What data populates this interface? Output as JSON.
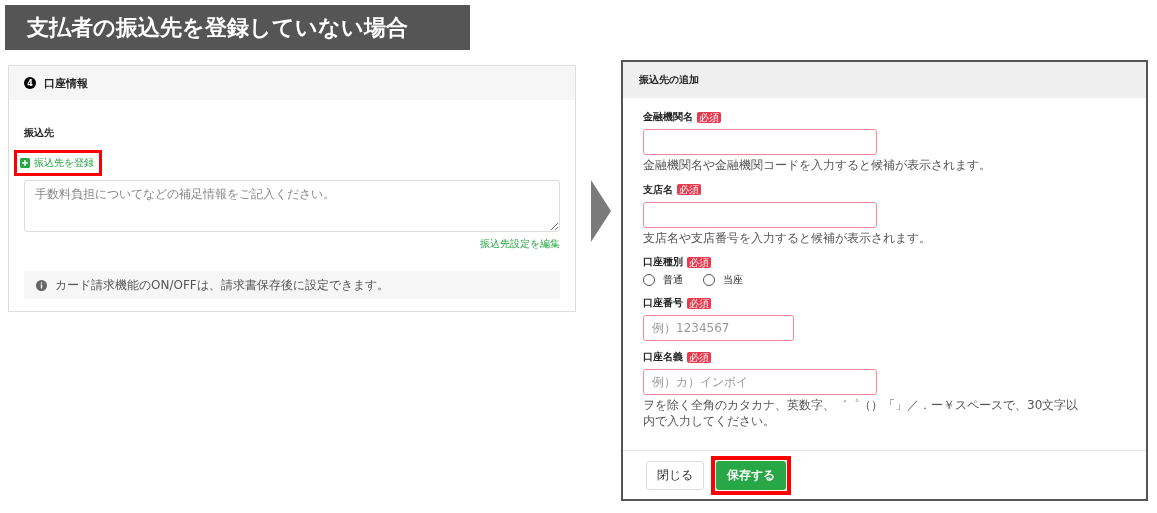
{
  "banner": {
    "title": "支払者の振込先を登録していない場合"
  },
  "account_card": {
    "step": "4",
    "title": "口座情報",
    "section_label": "振込先",
    "register_link": {
      "label": "振込先を登録",
      "highlighted": true
    },
    "note_field": {
      "placeholder": "手数料負担についてなどの補足情報をご記入ください。"
    },
    "edit_link": "振込先設定を編集",
    "info": "カード請求機能のON/OFFは、請求書保存後に設定できます。"
  },
  "dialog": {
    "title": "振込先の追加",
    "fields": [
      {
        "kind": "input",
        "label": "金融機関名",
        "required": "必須",
        "hint": "金融機関名や金融機関コードを入力すると候補が表示されます。"
      },
      {
        "kind": "input",
        "label": "支店名",
        "required": "必須",
        "hint": "支店名や支店番号を入力すると候補が表示されます。"
      },
      {
        "kind": "radio",
        "label": "口座種別",
        "required": "必須",
        "options": [
          {
            "label": "普通",
            "selected": false
          },
          {
            "label": "当座",
            "selected": false
          }
        ]
      },
      {
        "kind": "short_input",
        "label": "口座番号",
        "required": "必須",
        "placeholder": "例）1234567"
      },
      {
        "kind": "input",
        "label": "口座名義",
        "required": "必須",
        "placeholder": "例）カ）インボイ",
        "hint": "ヲを除く全角のカタカナ、英数字、゛゜（）「」／．ー￥スペースで、30文字以内で入力してください。"
      }
    ],
    "buttons": [
      {
        "kind": "secondary",
        "label": "閉じる",
        "highlighted": false
      },
      {
        "kind": "primary",
        "label": "保存する",
        "highlighted": true
      }
    ]
  }
}
